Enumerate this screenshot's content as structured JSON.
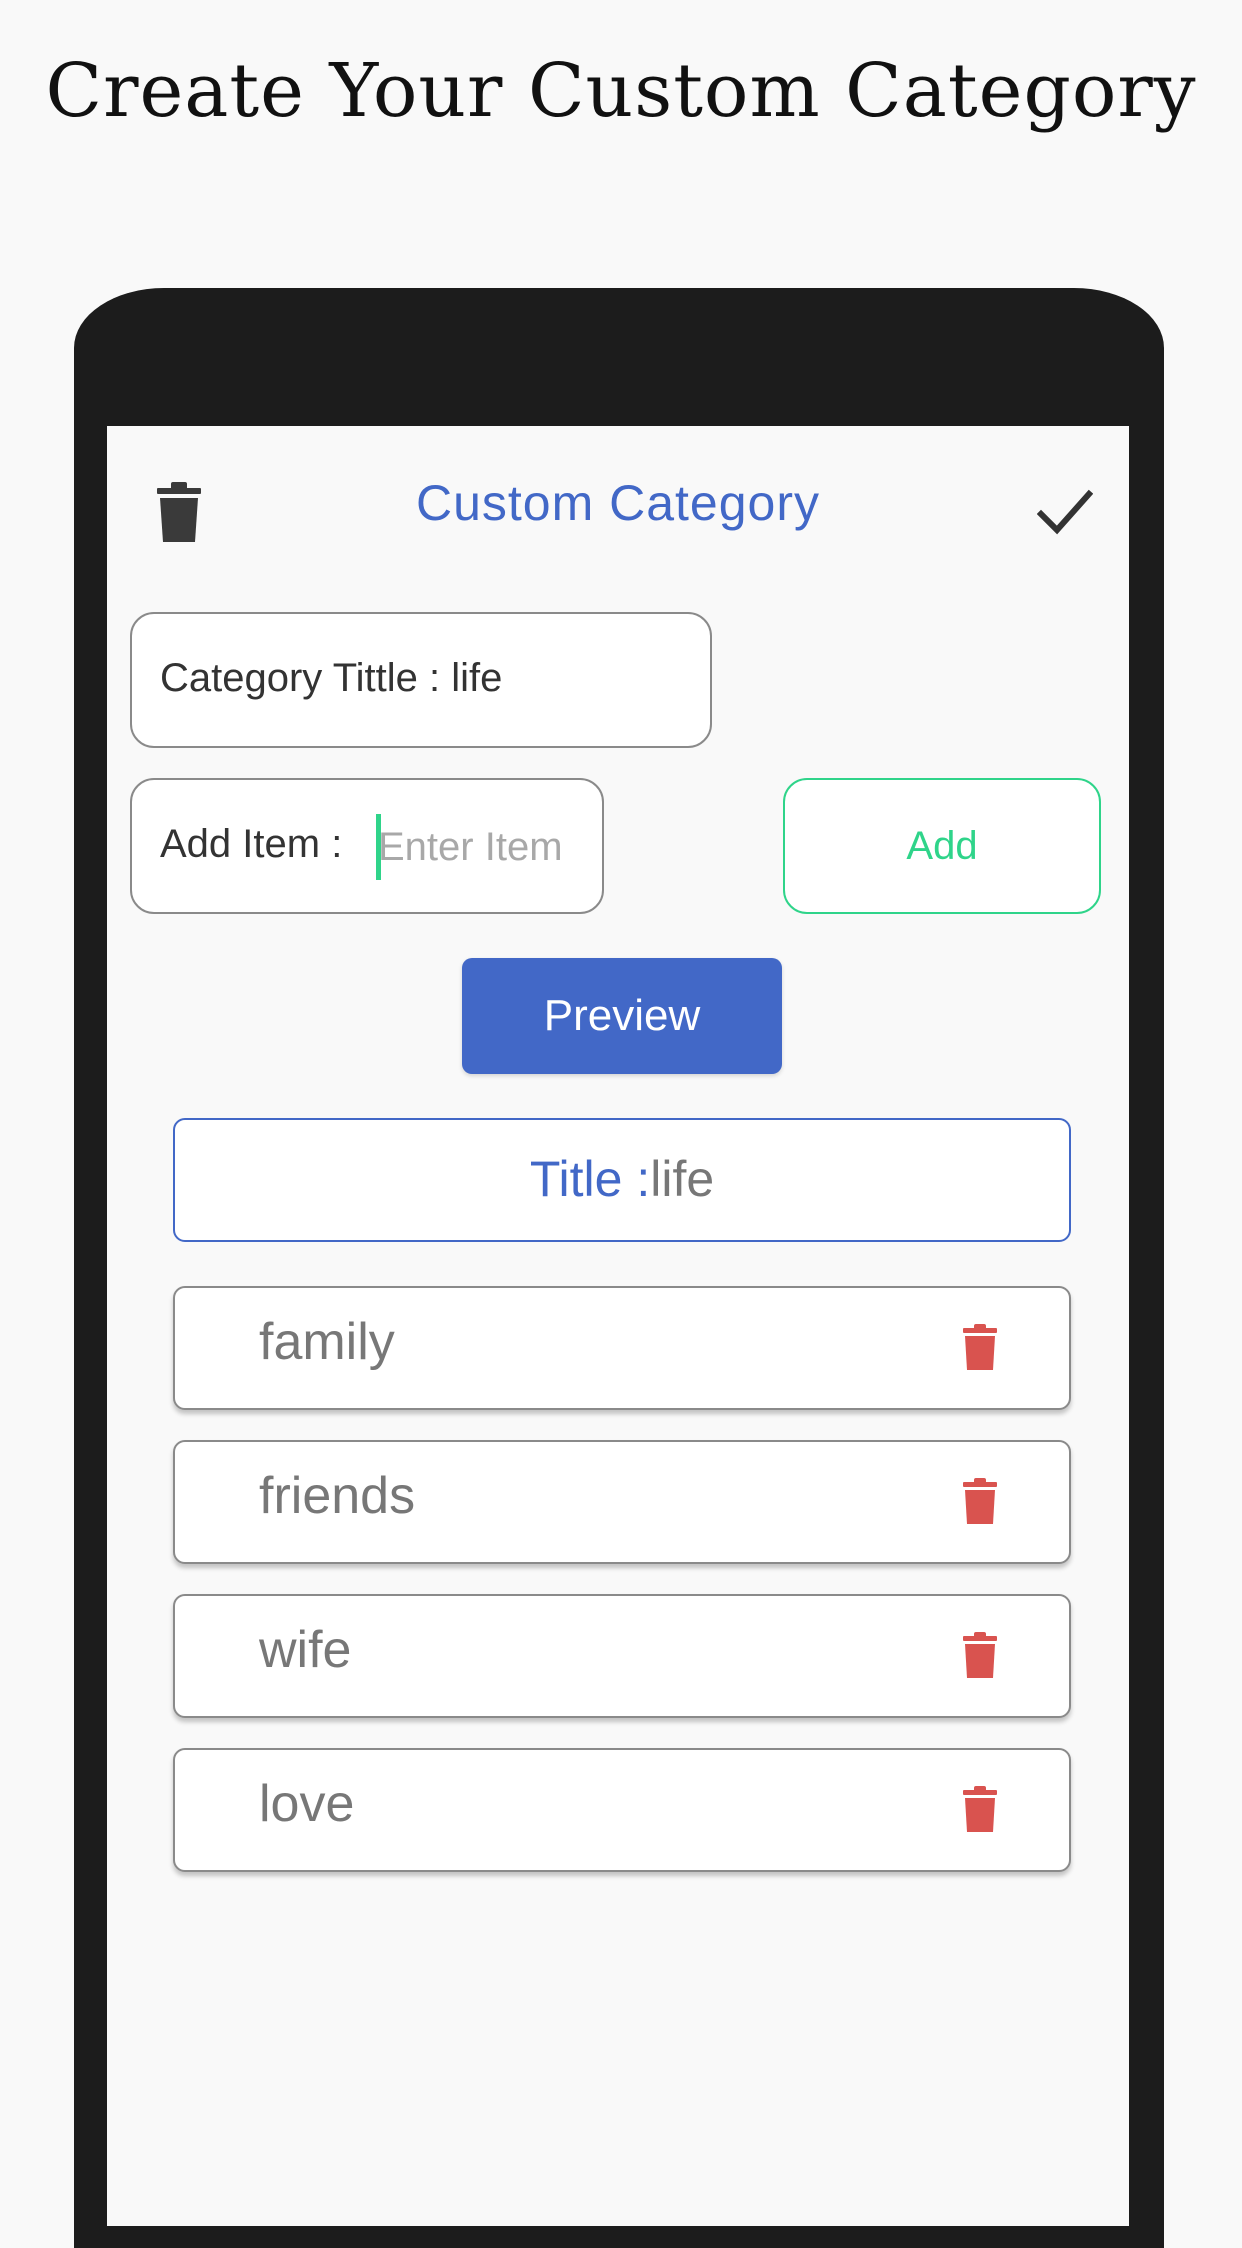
{
  "promo": {
    "headline": "Create Your Custom Category"
  },
  "app": {
    "title": "Custom Category",
    "header_icons": {
      "left": "trash-icon",
      "right": "check-icon"
    }
  },
  "form": {
    "category_field_text": "Category Tittle : life",
    "add_item_label": "Add Item : ",
    "add_item_value": "",
    "add_item_placeholder": "Enter Item",
    "add_button_label": "Add",
    "preview_button_label": "Preview"
  },
  "preview": {
    "title_label": "Title :",
    "title_value": "life",
    "items": [
      {
        "name": "family"
      },
      {
        "name": "friends"
      },
      {
        "name": "wife"
      },
      {
        "name": "love"
      }
    ],
    "delete_icon": "trash-icon"
  },
  "colors": {
    "primary_blue": "#4268c7",
    "accent_green": "#2fd48a",
    "delete_red": "#d9534f",
    "frame_dark": "#1c1c1c"
  }
}
